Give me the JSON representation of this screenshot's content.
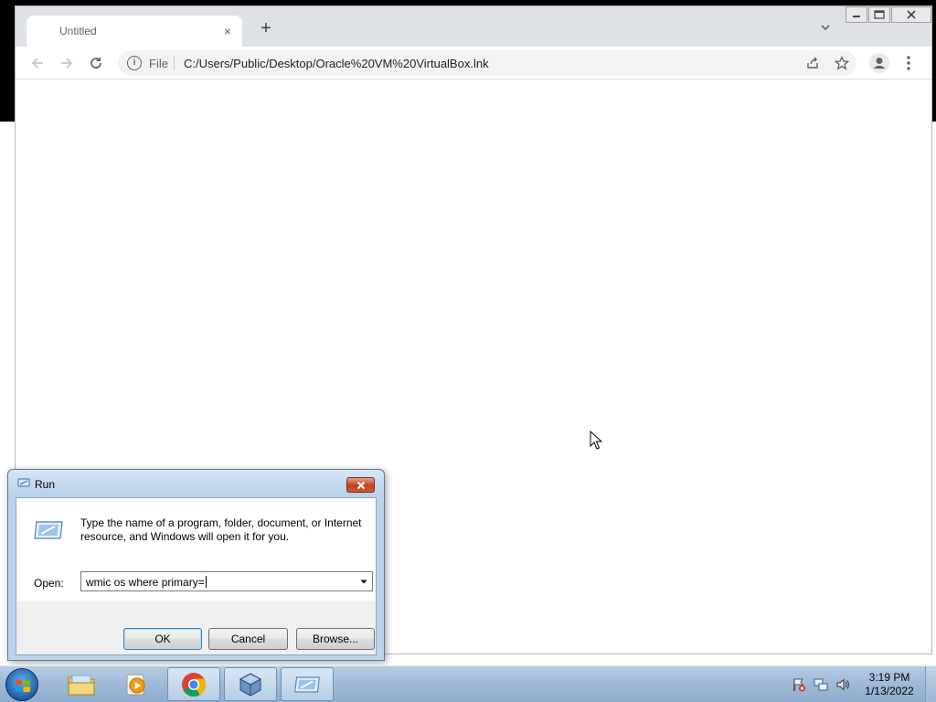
{
  "browser": {
    "tab_title": "Untitled",
    "tab_close_glyph": "×",
    "new_tab_glyph": "+",
    "scheme_label": "File",
    "url": "C:/Users/Public/Desktop/Oracle%20VM%20VirtualBox.lnk",
    "icons": [
      "back-icon",
      "forward-icon",
      "reload-icon",
      "info-icon",
      "share-icon",
      "star-icon",
      "profile-icon",
      "menu-icon",
      "tab-search-icon"
    ]
  },
  "run_dialog": {
    "title": "Run",
    "description": "Type the name of a program, folder, document, or Internet resource, and Windows will open it for you.",
    "open_label": "Open:",
    "input_value": "wmic os where primary=",
    "ok_label": "OK",
    "cancel_label": "Cancel",
    "browse_label": "Browse..."
  },
  "taskbar": {
    "pinned": [
      "windows-explorer",
      "media-player",
      "chrome",
      "virtualbox",
      "run"
    ],
    "time": "3:19 PM",
    "date": "1/13/2022"
  },
  "colors": {
    "taskbar": "#9fb9d6",
    "dialog_frame": "#bcd3ea",
    "close_red": "#c4401f",
    "chrome_tabstrip": "#dee1e6"
  }
}
